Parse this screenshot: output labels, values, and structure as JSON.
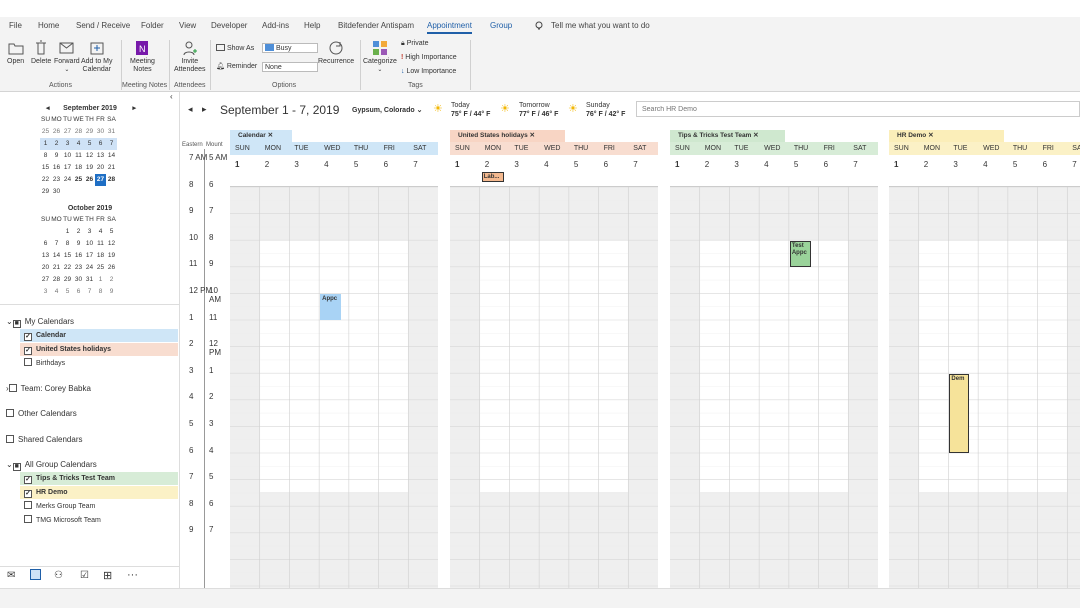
{
  "tabs": [
    "File",
    "Home",
    "Send / Receive",
    "Folder",
    "View",
    "Developer",
    "Add-ins",
    "Help",
    "Bitdefender Antispam",
    "Appointment",
    "Group"
  ],
  "tell_me": "Tell me what you want to do",
  "ribbon": {
    "open": "Open",
    "delete": "Delete",
    "forward": "Forward",
    "add_to_my": "Add to My",
    "calendar": "Calendar",
    "meeting": "Meeting",
    "notes": "Notes",
    "invite": "Invite",
    "attendees": "Attendees",
    "show_as": "Show As",
    "show_as_value": "Busy",
    "reminder": "Reminder",
    "reminder_value": "None",
    "recurrence": "Recurrence",
    "categorize": "Categorize",
    "private": "Private",
    "high": "High Importance",
    "low": "Low Importance",
    "groups": {
      "actions": "Actions",
      "meeting_notes": "Meeting Notes",
      "attendees": "Attendees",
      "options": "Options",
      "tags": "Tags"
    }
  },
  "minical": {
    "sep_title": "September 2019",
    "oct_title": "October 2019",
    "dow": [
      "SU",
      "MO",
      "TU",
      "WE",
      "TH",
      "FR",
      "SA"
    ],
    "sep_weeks": [
      [
        "25",
        "26",
        "27",
        "28",
        "29",
        "30",
        "31"
      ],
      [
        "1",
        "2",
        "3",
        "4",
        "5",
        "6",
        "7"
      ],
      [
        "8",
        "9",
        "10",
        "11",
        "12",
        "13",
        "14"
      ],
      [
        "15",
        "16",
        "17",
        "18",
        "19",
        "20",
        "21"
      ],
      [
        "22",
        "23",
        "24",
        "25",
        "26",
        "27",
        "28"
      ],
      [
        "29",
        "30",
        "",
        "",
        "",
        "",
        ""
      ]
    ],
    "oct_weeks": [
      [
        "",
        "",
        "1",
        "2",
        "3",
        "4",
        "5"
      ],
      [
        "6",
        "7",
        "8",
        "9",
        "10",
        "11",
        "12"
      ],
      [
        "13",
        "14",
        "15",
        "16",
        "17",
        "18",
        "19"
      ],
      [
        "20",
        "21",
        "22",
        "23",
        "24",
        "25",
        "26"
      ],
      [
        "27",
        "28",
        "29",
        "30",
        "31",
        "1",
        "2"
      ],
      [
        "3",
        "4",
        "5",
        "6",
        "7",
        "8",
        "9"
      ]
    ]
  },
  "folders": {
    "my_calendars": "My Calendars",
    "calendar": "Calendar",
    "us_holidays": "United States holidays",
    "birthdays": "Birthdays",
    "team": "Team: Corey Babka",
    "other": "Other Calendars",
    "shared": "Shared Calendars",
    "all_group": "All Group Calendars",
    "tips": "Tips & Tricks Test Team",
    "hr": "HR Demo",
    "merks": "Merks Group Team",
    "tmg": "TMG Microsoft Team"
  },
  "header": {
    "range": "September 1 - 7, 2019",
    "location": "Gypsum, Colorado",
    "weather": [
      {
        "label": "Today",
        "temp": "75° F / 44° F"
      },
      {
        "label": "Tomorrow",
        "temp": "77° F / 46° F"
      },
      {
        "label": "Sunday",
        "temp": "76° F / 42° F"
      }
    ],
    "search_placeholder": "Search HR Demo"
  },
  "time_labels": {
    "left_zone": "Eastern",
    "right_zone": "Mount"
  },
  "hours_left": [
    "7 AM",
    "8",
    "9",
    "10",
    "11",
    "12 PM",
    "1",
    "2",
    "3",
    "4",
    "5",
    "6",
    "7",
    "8",
    "9"
  ],
  "hours_right": [
    "5 AM",
    "6",
    "7",
    "8",
    "9",
    "10 AM",
    "11",
    "12 PM",
    "1",
    "2",
    "3",
    "4",
    "5",
    "6",
    "7"
  ],
  "days": [
    "SUN",
    "MON",
    "TUE",
    "WED",
    "THU",
    "FRI",
    "SAT"
  ],
  "dates": [
    "1",
    "2",
    "3",
    "4",
    "5",
    "6",
    "7"
  ],
  "calendars": [
    {
      "name": "Calendar",
      "color": "#cfe6f7",
      "tab": "#cfe6f7",
      "events": [
        {
          "text": "Appc",
          "day": 3,
          "start": 4,
          "len": 1,
          "bg": "#a9d3f5",
          "border": "#a9d3f5"
        }
      ]
    },
    {
      "name": "United States holidays",
      "color": "#f8ddd0",
      "tab": "#f8d5c4",
      "allday": "Lab..."
    },
    {
      "name": "Tips & Tricks Test Team",
      "color": "#d7ecd7",
      "tab": "#cfe8cf",
      "events": [
        {
          "text": "Test Appc",
          "day": 4,
          "start": 2,
          "len": 1,
          "bg": "#9ad39a",
          "border": "#333"
        }
      ]
    },
    {
      "name": "HR Demo",
      "color": "#fbf1c6",
      "tab": "#fbeeb9",
      "events": [
        {
          "text": "Dem",
          "day": 2,
          "start": 7,
          "len": 3,
          "bg": "#f6e39a",
          "border": "#333"
        }
      ]
    }
  ],
  "colors": {
    "accent": "#1f5fa8",
    "today": "#1f6fc5"
  }
}
